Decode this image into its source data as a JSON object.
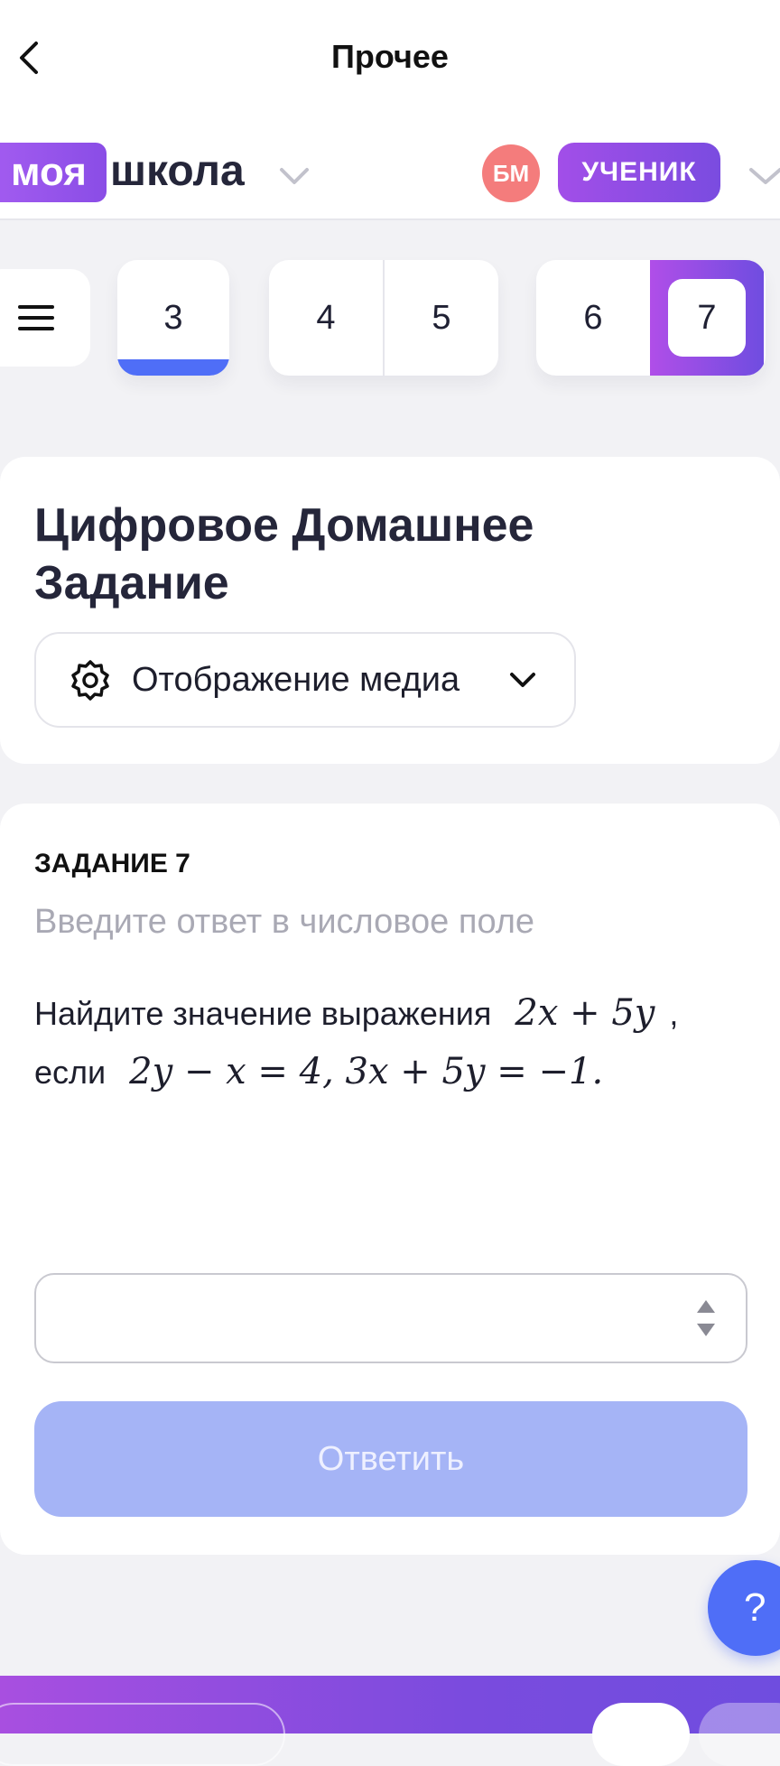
{
  "header": {
    "title": "Прочее",
    "back_icon": "chevron-left-icon"
  },
  "brand": {
    "part1": "моя",
    "part2": "школа",
    "avatar_initials": "БМ",
    "role_label": "УЧЕНИК",
    "accent_color": "#8a4de6",
    "avatar_color": "#f47c7c"
  },
  "task_tabs": {
    "menu_icon": "hamburger-menu-icon",
    "items": [
      "3",
      "4",
      "5",
      "6",
      "7"
    ],
    "completed": "3",
    "selected": "7"
  },
  "homework": {
    "title": "Цифровое Домашнее Задание",
    "media_select_label": "Отображение медиа",
    "media_icon": "gear-icon"
  },
  "task": {
    "label": "ЗАДАНИЕ 7",
    "hint": "Введите ответ в числовое поле",
    "question_prefix": "Найдите значение выражения",
    "expression": "2x + 5y",
    "comma": ",",
    "condition_prefix": "если",
    "condition": "2y − x = 4, 3x + 5y = −1.",
    "answer_value": "",
    "submit_label": "Ответить",
    "submit_color": "#a5b4f6"
  },
  "help": {
    "label": "?"
  }
}
